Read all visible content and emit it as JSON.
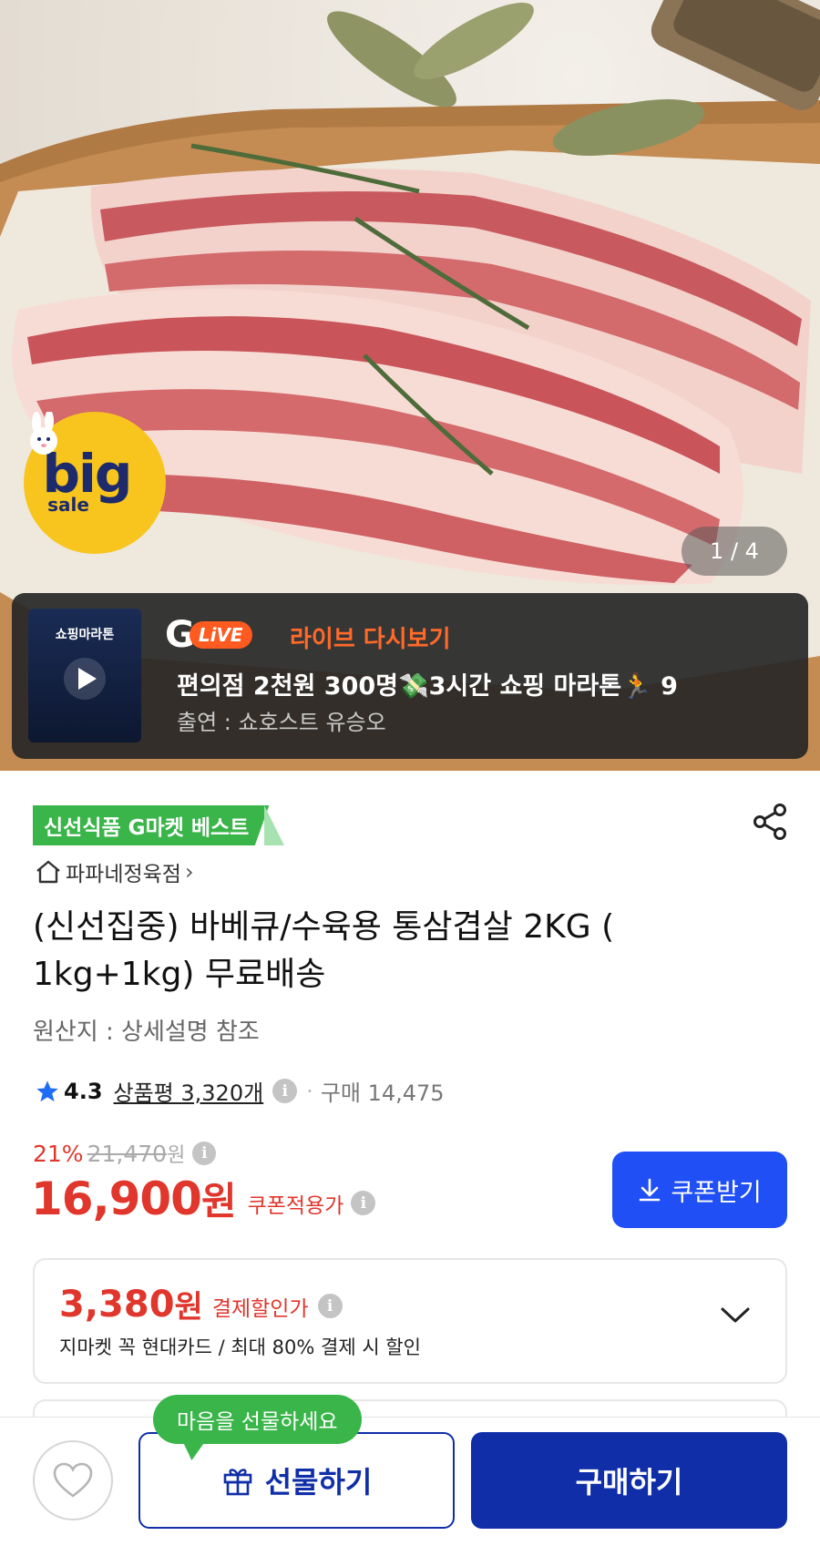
{
  "hero": {
    "image_counter": "1 / 4",
    "big_sale_badge": {
      "big": "big",
      "sale": "sale"
    }
  },
  "live": {
    "thumb_title": "쇼핑마라톤",
    "logo_g": "G",
    "logo_live": "LiVE",
    "replay_label": "라이브 다시보기",
    "title": "편의점 2천원 300명💸3시간 쇼핑 마라톤🏃 9",
    "host": "출연 : 쇼호스트 유승오"
  },
  "product": {
    "badge": "신선식품 G마켓 베스트",
    "store": "파파네정육점",
    "title": "(신선집중) 바베큐/수육용 통삼겹살 2KG ( 1kg+1kg) 무료배송",
    "origin": "원산지 : 상세설명 참조",
    "rating": "4.3",
    "reviews": "상품평 3,320개",
    "purchases": "구매 14,475",
    "discount_pct": "21%",
    "original_price": "21,470",
    "original_unit": "원",
    "price": "16,900",
    "price_unit": "원",
    "price_label": "쿠폰적용가",
    "coupon_button": "쿠폰받기"
  },
  "card_discount": {
    "amount": "3,380",
    "unit": "원",
    "label": "결제할인가",
    "desc": "지마켓 꼭 현대카드 / 최대 80% 결제 시 할인"
  },
  "bottom": {
    "tooltip": "마음을 선물하세요",
    "gift_button": "선물하기",
    "buy_button": "구매하기"
  },
  "colors": {
    "accent_red": "#e0362c",
    "coupon_blue": "#1f4ff5",
    "buy_navy": "#0f2ea8",
    "badge_green": "#3ab54a",
    "live_orange": "#ff6a2a"
  },
  "icons": [
    "play-icon",
    "share-icon",
    "home-icon",
    "chevron-right-icon",
    "star-icon",
    "info-icon",
    "download-icon",
    "chevron-down-icon",
    "heart-icon",
    "gift-icon"
  ]
}
